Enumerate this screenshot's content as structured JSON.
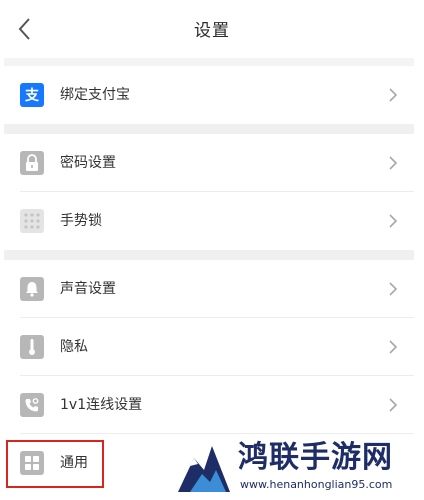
{
  "header": {
    "title": "设置",
    "back_icon": "chevron-left-icon"
  },
  "accent_color": "#1677ff",
  "highlight_color": "#d9261c",
  "groups": [
    {
      "items": [
        {
          "label": "绑定支付宝",
          "icon": "alipay-icon"
        }
      ]
    },
    {
      "items": [
        {
          "label": "密码设置",
          "icon": "lock-icon"
        },
        {
          "label": "手势锁",
          "icon": "gesture-grid-icon"
        }
      ]
    },
    {
      "items": [
        {
          "label": "声音设置",
          "icon": "bell-icon"
        },
        {
          "label": "隐私",
          "icon": "thermometer-icon"
        },
        {
          "label": "1v1连线设置",
          "icon": "phone-icon"
        },
        {
          "label": "通用",
          "icon": "grid-icon"
        }
      ]
    }
  ],
  "watermark": {
    "text": "鸿联手游网",
    "url": "www.henanhonglian95.com"
  }
}
